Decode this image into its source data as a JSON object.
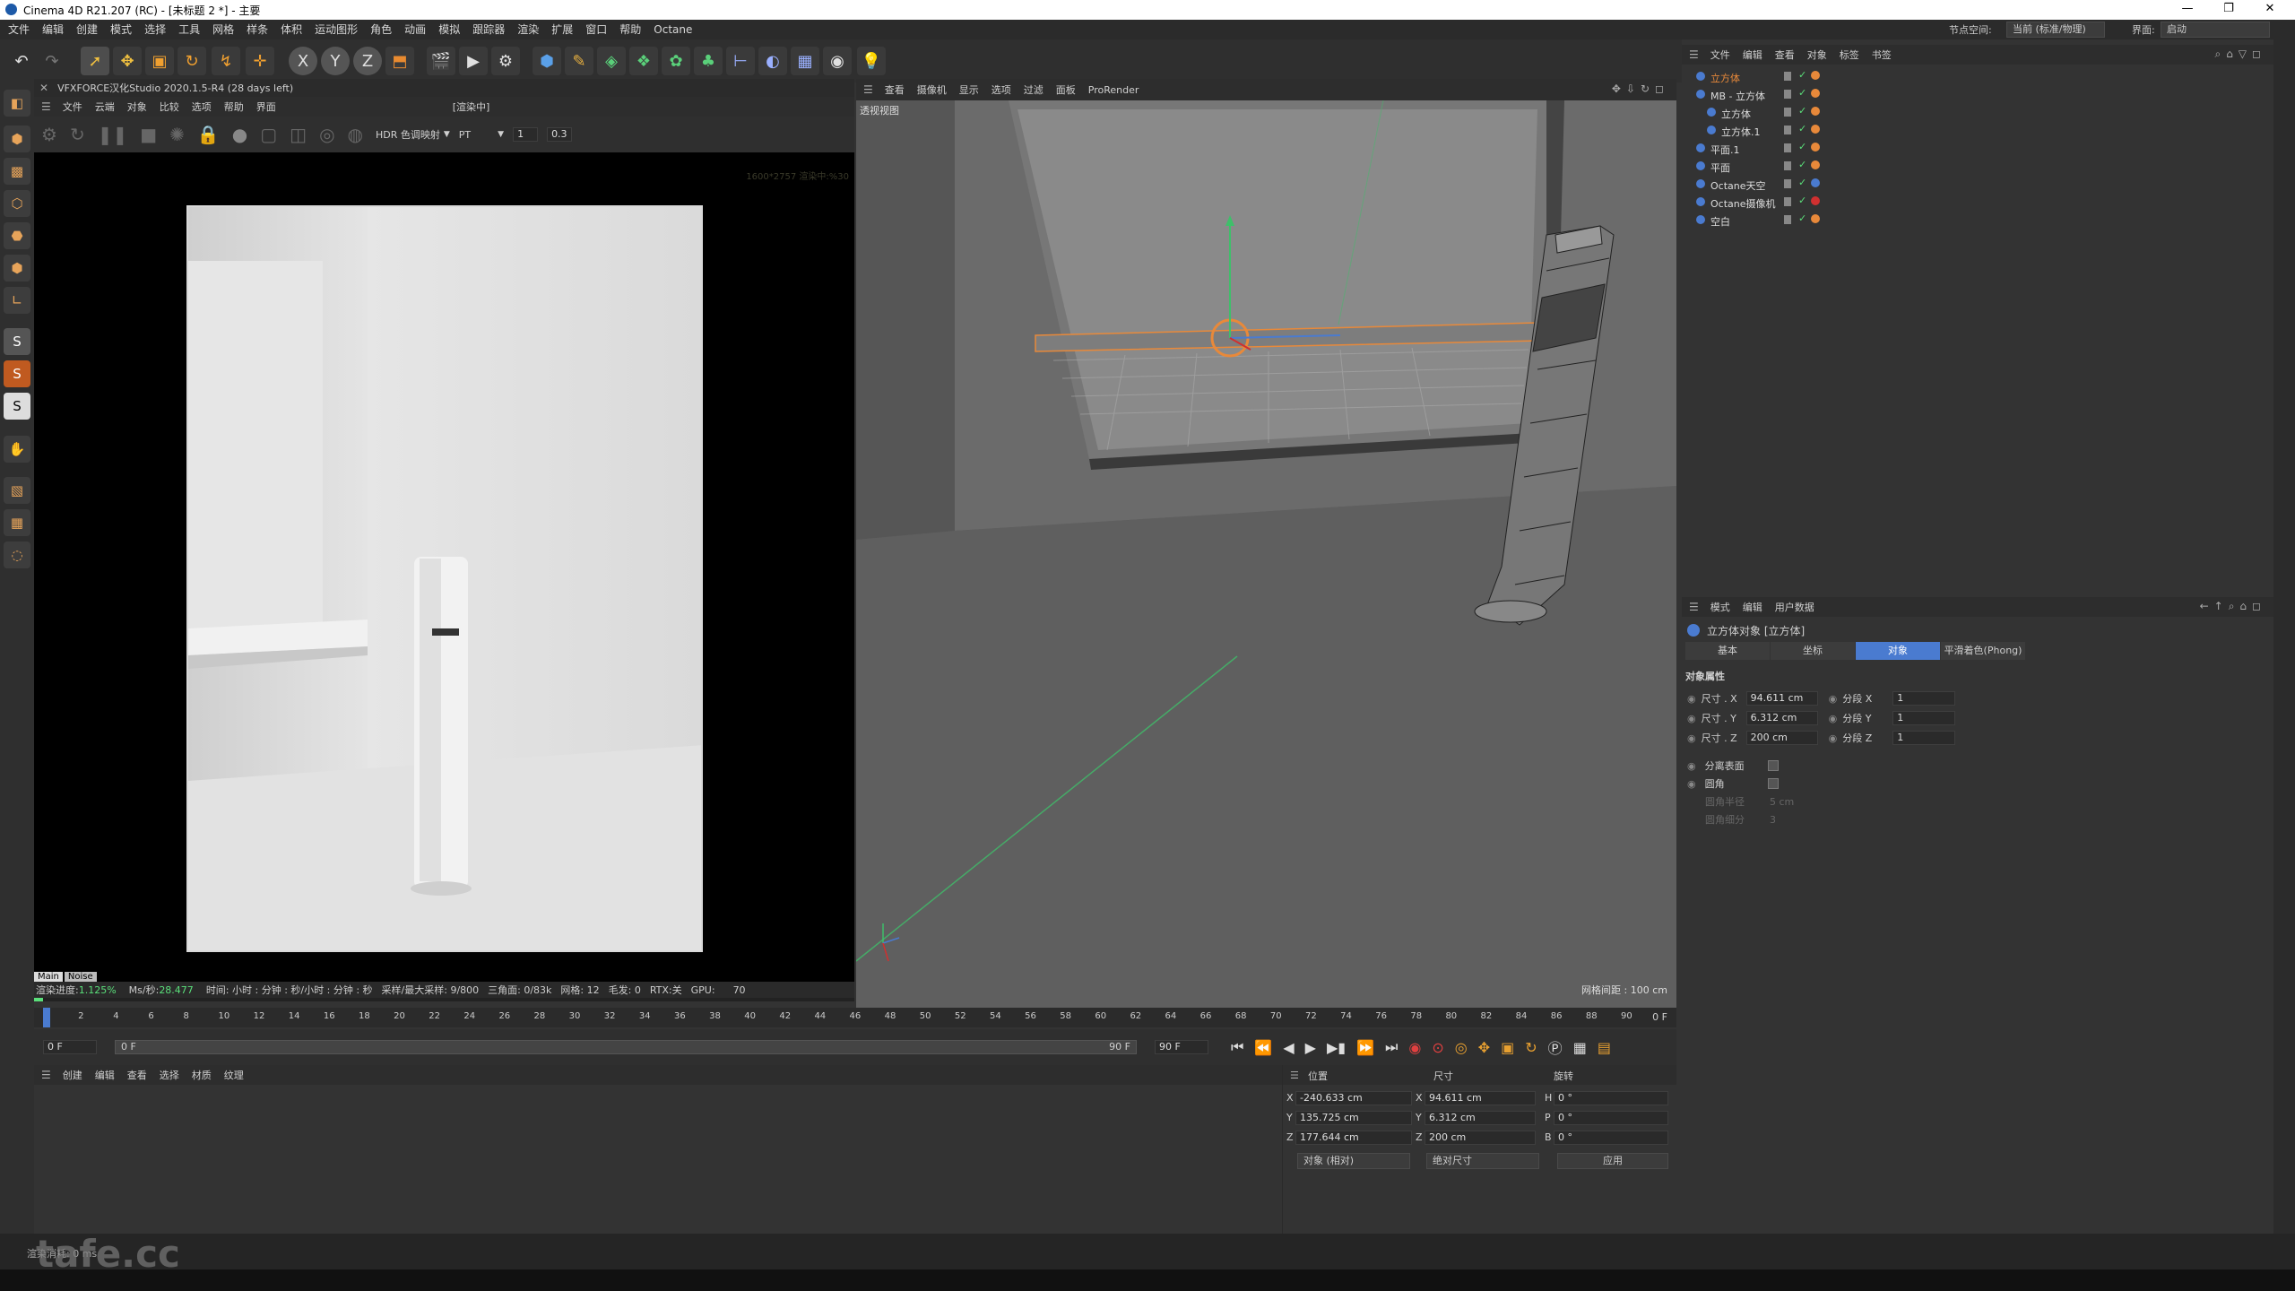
{
  "window": {
    "title": "Cinema 4D R21.207 (RC) - [未标题 2 *] - 主要",
    "controls": [
      "—",
      "❐",
      "✕"
    ]
  },
  "menubar": {
    "items": [
      "文件",
      "编辑",
      "创建",
      "模式",
      "选择",
      "工具",
      "网格",
      "样条",
      "体积",
      "运动图形",
      "角色",
      "动画",
      "模拟",
      "跟踪器",
      "渲染",
      "扩展",
      "窗口",
      "帮助",
      "Octane"
    ],
    "node_space_label": "节点空间:",
    "node_space_value": "当前 (标准/物理)",
    "layout_label": "界面:",
    "layout_value": "启动"
  },
  "toolbar": {
    "tools": [
      "undo-icon",
      "redo-icon",
      "select-icon",
      "move-icon",
      "scale-icon",
      "rotate-icon",
      "recent-tool-icon",
      "add-icon",
      "x-axis-icon",
      "y-axis-icon",
      "z-axis-icon",
      "world-coord-icon",
      "render-region-icon",
      "render-view-icon",
      "render-settings-icon",
      "cube-icon",
      "pen-icon",
      "subdivision-icon",
      "cloner-icon",
      "deformer-icon",
      "scene-icon",
      "camera-icon",
      "floor-icon",
      "material-icon",
      "light-icon",
      "bulb-icon"
    ],
    "axis_labels": [
      "X",
      "Y",
      "Z"
    ]
  },
  "render_view": {
    "title": "VFXFORCE汉化Studio 2020.1.5-R4 (28 days left)",
    "menu": [
      "文件",
      "云端",
      "对象",
      "比较",
      "选项",
      "帮助",
      "界面"
    ],
    "status_tag": "[渲染中]",
    "tonemap": "HDR 色调映射",
    "kernel": "PT",
    "value1": "1",
    "value2": "0.3",
    "resolution_overlay": "1600*2757 渲染中:%30",
    "tabs": [
      "Main",
      "Noise"
    ],
    "status": {
      "progress_label": "渲染进度:",
      "progress_value": "1.125%",
      "ms_label": "Ms/秒:",
      "ms_value": "28.477",
      "time": "时间: 小时 : 分钟 : 秒/小时 : 分钟 : 秒",
      "samples": "采样/最大采样: 9/800",
      "triangles": "三角面: 0/83k",
      "meshes": "网格: 12",
      "hair": "毛发: 0",
      "rtx": "RTX:关",
      "gpu_label": "GPU:",
      "gpu_value": "70"
    }
  },
  "viewport": {
    "menu": [
      "查看",
      "摄像机",
      "显示",
      "选项",
      "过滤",
      "面板",
      "ProRender"
    ],
    "label": "透视视图",
    "grid_spacing": "网格间距 : 100 cm"
  },
  "timeline": {
    "ticks": [
      "0",
      "2",
      "4",
      "6",
      "8",
      "10",
      "12",
      "14",
      "16",
      "18",
      "20",
      "22",
      "24",
      "26",
      "28",
      "30",
      "32",
      "34",
      "36",
      "38",
      "40",
      "42",
      "44",
      "46",
      "48",
      "50",
      "52",
      "54",
      "56",
      "58",
      "60",
      "62",
      "64",
      "66",
      "68",
      "70",
      "72",
      "74",
      "76",
      "78",
      "80",
      "82",
      "84",
      "86",
      "88",
      "90"
    ],
    "current_frame": "0 F",
    "start": "0 F",
    "min": "0 F",
    "max": "90 F",
    "end": "90 F"
  },
  "material_manager": {
    "menu": [
      "创建",
      "编辑",
      "查看",
      "选择",
      "材质",
      "纹理"
    ]
  },
  "coordinates": {
    "headers": [
      "位置",
      "尺寸",
      "旋转"
    ],
    "rows": [
      {
        "axis": "X",
        "pos": "-240.633 cm",
        "size_axis": "X",
        "size": "94.611 cm",
        "rot_axis": "H",
        "rot": "0 °"
      },
      {
        "axis": "Y",
        "pos": "135.725 cm",
        "size_axis": "Y",
        "size": "6.312 cm",
        "rot_axis": "P",
        "rot": "0 °"
      },
      {
        "axis": "Z",
        "pos": "177.644 cm",
        "size_axis": "Z",
        "size": "200 cm",
        "rot_axis": "B",
        "rot": "0 °"
      }
    ],
    "mode1": "对象 (相对)",
    "mode2": "绝对尺寸",
    "apply": "应用"
  },
  "object_manager": {
    "menu": [
      "文件",
      "编辑",
      "查看",
      "对象",
      "标签",
      "书签"
    ],
    "objects": [
      {
        "name": "立方体",
        "indent": 0,
        "selected": true
      },
      {
        "name": "MB - 立方体",
        "indent": 0,
        "selected": false
      },
      {
        "name": "立方体",
        "indent": 1,
        "selected": false
      },
      {
        "name": "立方体.1",
        "indent": 1,
        "selected": false
      },
      {
        "name": "平面.1",
        "indent": 0,
        "selected": false
      },
      {
        "name": "平面",
        "indent": 0,
        "selected": false
      },
      {
        "name": "Octane天空",
        "indent": 0,
        "selected": false
      },
      {
        "name": "Octane摄像机",
        "indent": 0,
        "selected": false
      },
      {
        "name": "空白",
        "indent": 0,
        "selected": false
      }
    ]
  },
  "attribute_manager": {
    "menu": [
      "模式",
      "编辑",
      "用户数据"
    ],
    "object_title": "立方体对象 [立方体]",
    "tabs": [
      "基本",
      "坐标",
      "对象",
      "平滑着色(Phong)"
    ],
    "active_tab": "对象",
    "section": "对象属性",
    "props": [
      {
        "label": "尺寸 . X",
        "value": "94.611 cm",
        "seg_label": "分段 X",
        "seg": "1"
      },
      {
        "label": "尺寸 . Y",
        "value": "6.312 cm",
        "seg_label": "分段 Y",
        "seg": "1"
      },
      {
        "label": "尺寸 . Z",
        "value": "200 cm",
        "seg_label": "分段 Z",
        "seg": "1"
      }
    ],
    "separate_surfaces": "分离表面",
    "fillet": "圆角",
    "fillet_radius": "圆角半径",
    "fillet_radius_value": "5 cm",
    "fillet_subdivision": "圆角细分",
    "fillet_subdivision_value": "3"
  },
  "statusbar": {
    "text": "渲染消耗: 0 ms",
    "watermark": "tafe.cc"
  },
  "colors": {
    "accent_blue": "#4a7bd0",
    "selected_orange": "#e8893a",
    "axis_green": "#3fbf6a",
    "panel_bg": "#333333"
  }
}
